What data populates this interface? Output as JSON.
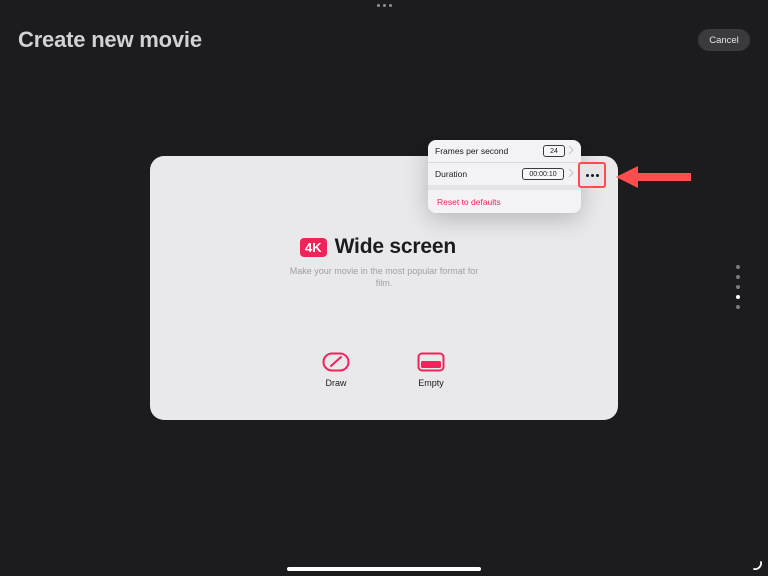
{
  "header": {
    "title": "Create new movie",
    "cancel_label": "Cancel"
  },
  "card": {
    "badge": "4K",
    "title": "Wide screen",
    "description": "Make your movie in the most popular format for film.",
    "options": [
      {
        "label": "Draw",
        "icon": "pencil-icon"
      },
      {
        "label": "Empty",
        "icon": "empty-frame-icon"
      }
    ]
  },
  "popover": {
    "rows": [
      {
        "label": "Frames per second",
        "value": "24"
      },
      {
        "label": "Duration",
        "value": "00:00:10"
      }
    ],
    "reset_label": "Reset to defaults"
  },
  "annotation": {
    "highlight_color": "#ff4d4d",
    "highlight_target": "more-options-button"
  },
  "pager": {
    "count": 5,
    "active_index": 3
  },
  "colors": {
    "background": "#1c1c1e",
    "accent": "#f0245a",
    "card": "#e9e9eb"
  }
}
